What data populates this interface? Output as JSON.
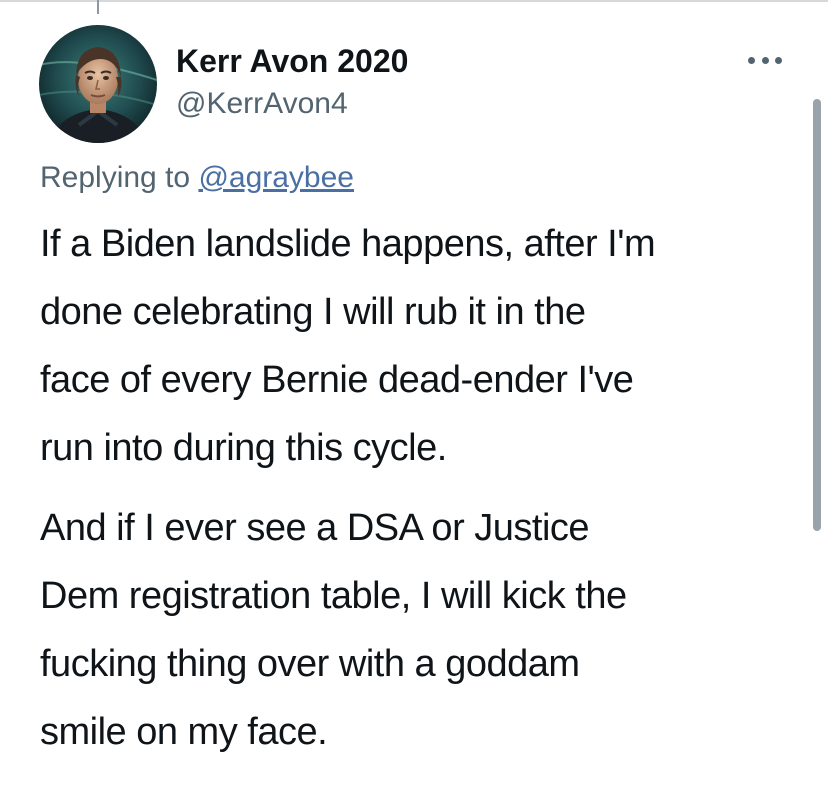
{
  "tweet": {
    "author": {
      "display_name": "Kerr Avon 2020",
      "handle": "@KerrAvon4"
    },
    "replying_to": {
      "prefix": "Replying to",
      "mention": "@agraybee"
    },
    "paragraphs": [
      {
        "lines": [
          "If a Biden landslide happens, after I'm",
          "done celebrating I will rub it in the",
          "face of every Bernie dead-ender I've",
          "run into during this cycle."
        ]
      },
      {
        "lines": [
          "And if I ever see a DSA or Justice",
          "Dem registration table, I will kick the",
          "fucking thing over with a goddam",
          "smile on my face."
        ]
      }
    ]
  },
  "icons": {
    "more": "more-horizontal-icon"
  },
  "colors": {
    "text": "#0f1419",
    "secondary_text": "#536471",
    "mention_link": "#4a6fa5",
    "background": "#ffffff"
  }
}
